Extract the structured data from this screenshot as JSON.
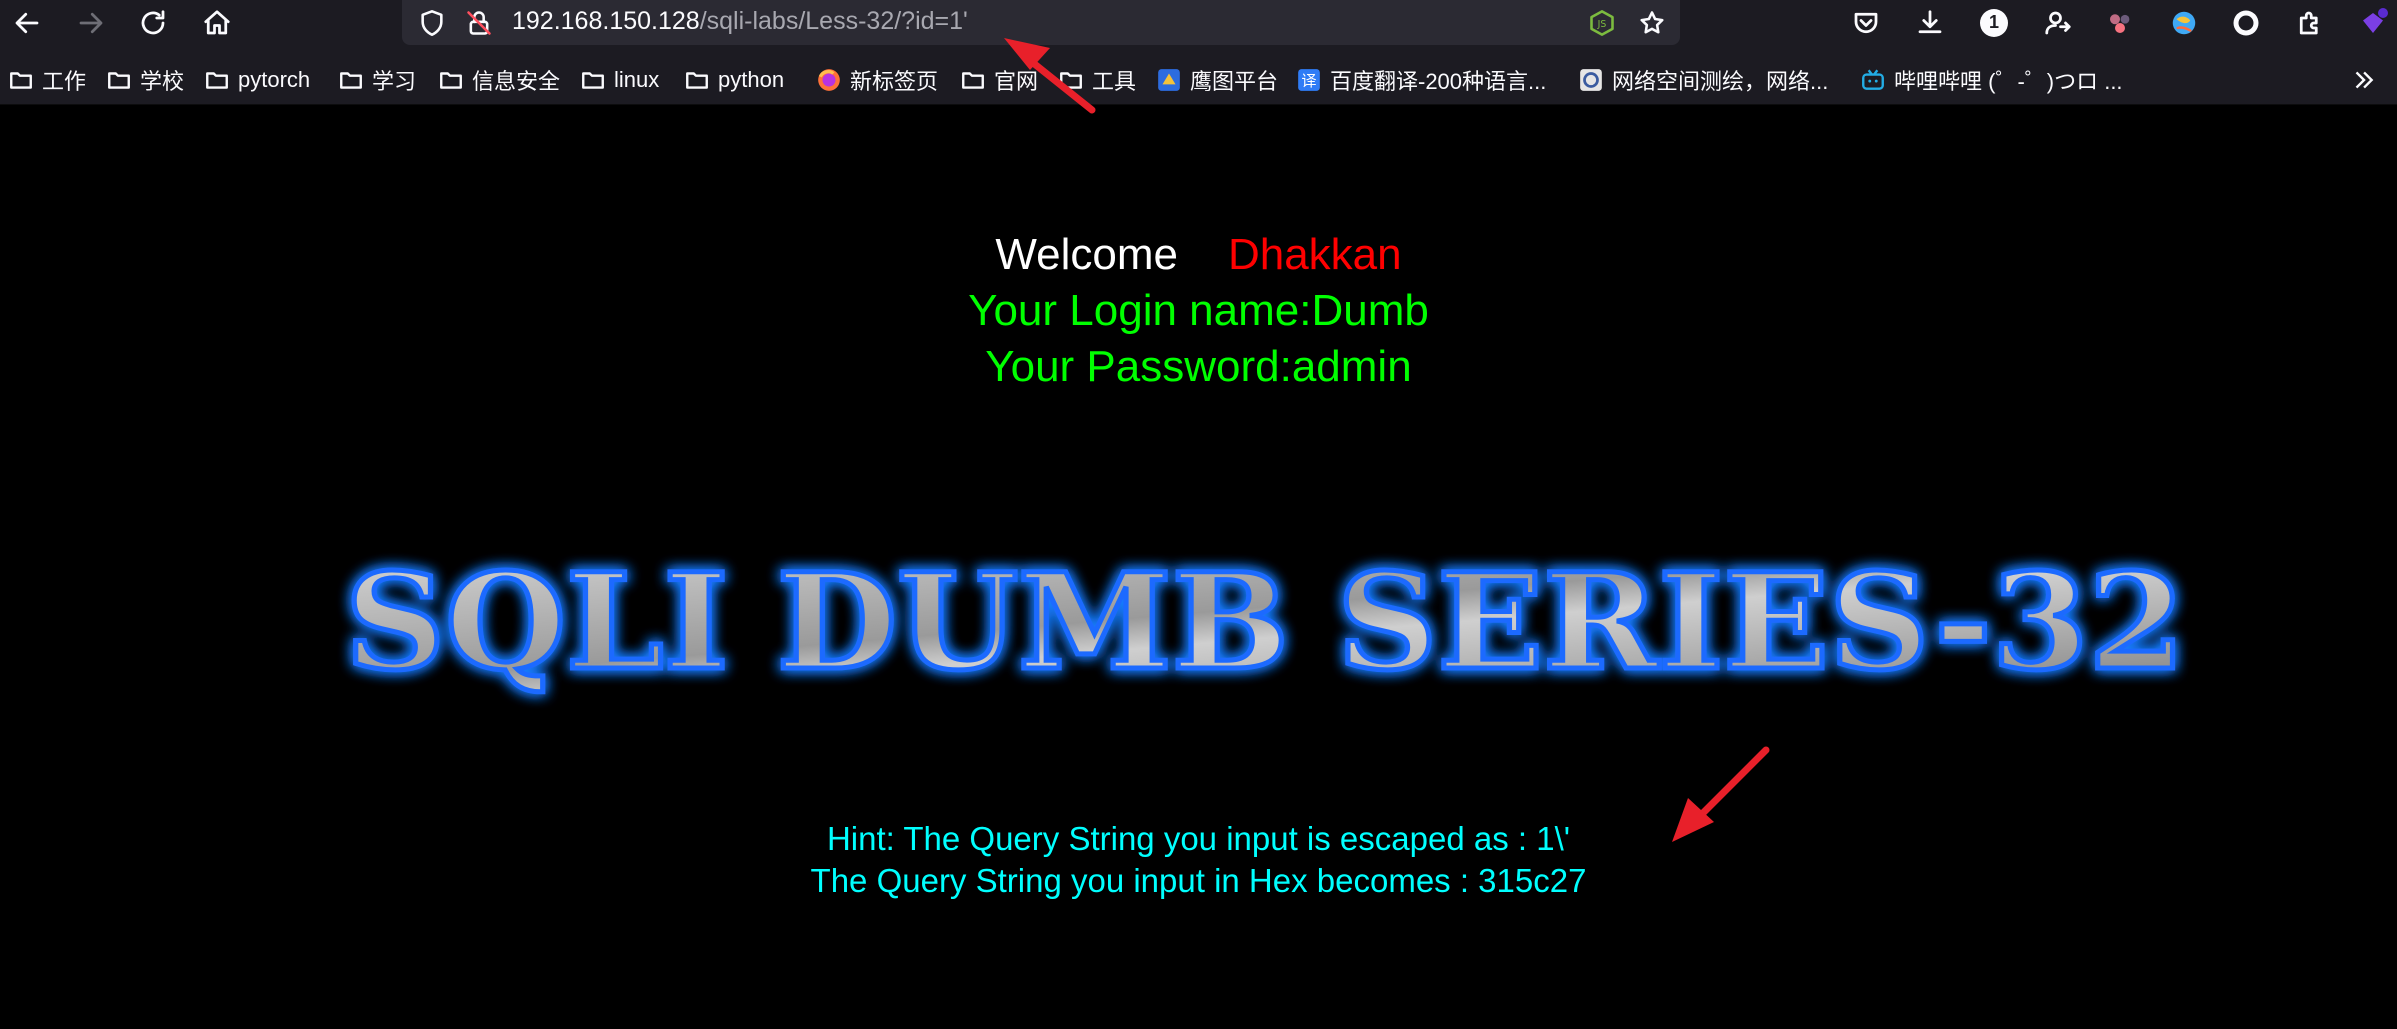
{
  "browser": {
    "url": {
      "host": "192.168.150.128",
      "path": "/sqli-labs/Less-32/?id=1'"
    },
    "downloads_badge": "1",
    "bookmarks": [
      {
        "label": "工作",
        "icon": "folder-icon"
      },
      {
        "label": "学校",
        "icon": "folder-icon"
      },
      {
        "label": "pytorch",
        "icon": "folder-icon"
      },
      {
        "label": "学习",
        "icon": "folder-icon"
      },
      {
        "label": "信息安全",
        "icon": "folder-icon"
      },
      {
        "label": "linux",
        "icon": "folder-icon"
      },
      {
        "label": "python",
        "icon": "folder-icon"
      },
      {
        "label": "新标签页",
        "icon": "firefox-icon"
      },
      {
        "label": "官网",
        "icon": "folder-icon"
      },
      {
        "label": "工具",
        "icon": "folder-icon"
      },
      {
        "label": "鹰图平台",
        "icon": "hunter-icon"
      },
      {
        "label": "百度翻译-200种语言...",
        "icon": "translate-icon"
      },
      {
        "label": "网络空间测绘，网络...",
        "icon": "fofa-icon"
      },
      {
        "label": "哔哩哔哩 (゜-゜)つロ ...",
        "icon": "bilibili-icon"
      }
    ],
    "translate_icon_char": "译"
  },
  "page": {
    "welcome_word": "Welcome",
    "welcome_name": "Dhakkan",
    "login_line": "Your Login name:Dumb",
    "password_line": "Your Password:admin",
    "series_title": "SQLI DUMB SERIES-32",
    "hint_line": "Hint: The Query String you input is escaped as : 1\\'",
    "hex_line": "The Query String you input in Hex becomes : 315c27"
  },
  "colors": {
    "welcome": "#ffffff",
    "name": "#ff0000",
    "credentials": "#00ff00",
    "hint": "#00ffff",
    "annotation_arrow": "#e8202a"
  }
}
